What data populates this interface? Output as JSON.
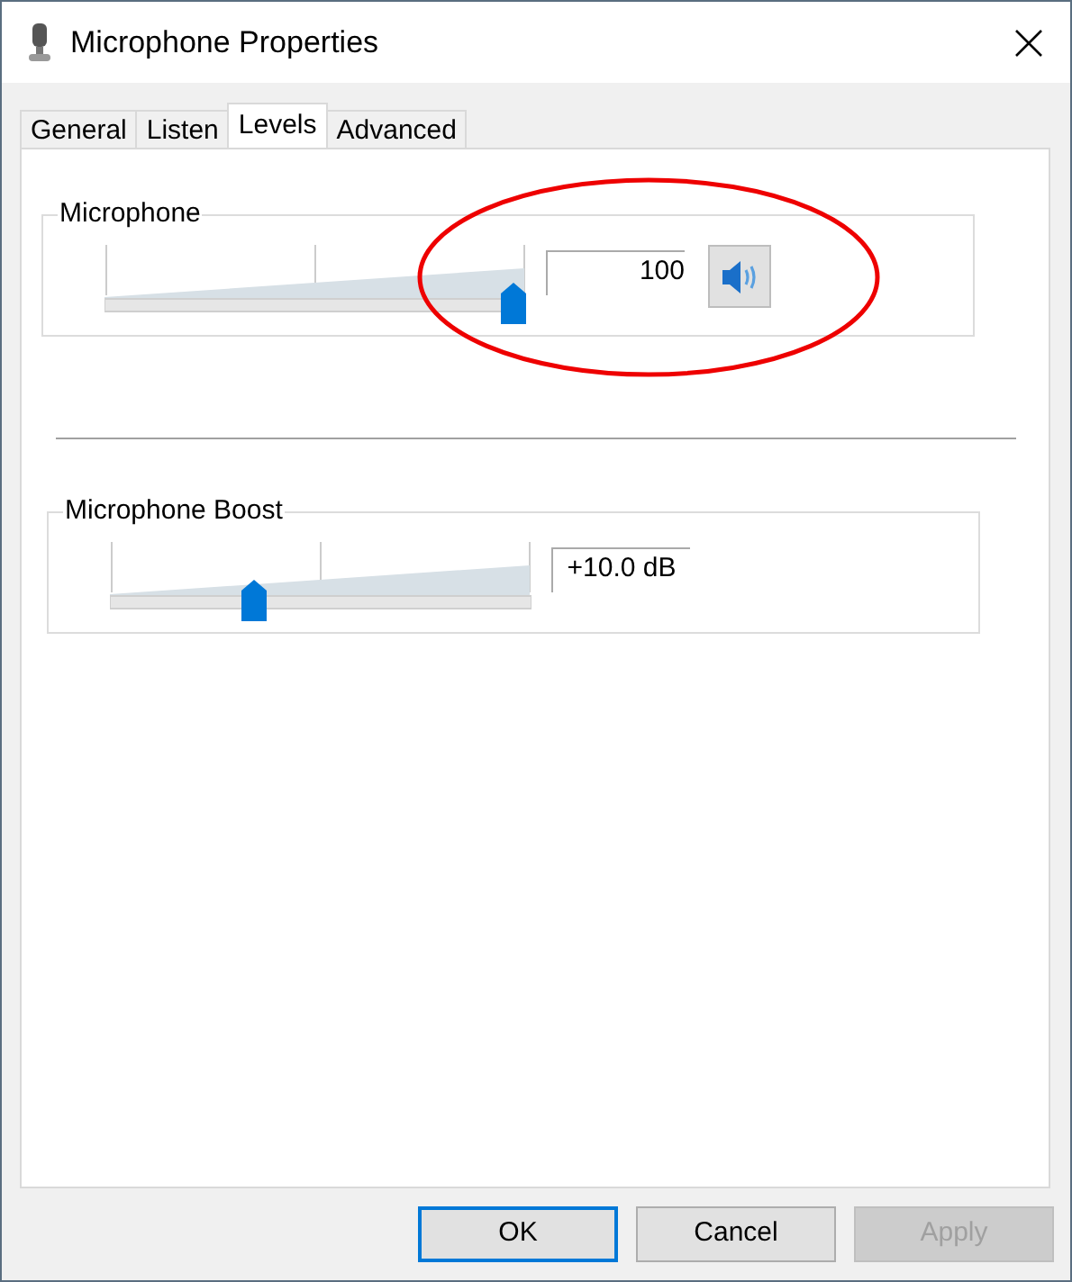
{
  "window": {
    "title": "Microphone Properties"
  },
  "tabs": [
    {
      "label": "General",
      "selected": false
    },
    {
      "label": "Listen",
      "selected": false
    },
    {
      "label": "Levels",
      "selected": true
    },
    {
      "label": "Advanced",
      "selected": false
    }
  ],
  "groups": [
    {
      "label": "Microphone",
      "level": 1.0,
      "reading": "100",
      "muted": false
    },
    {
      "label": "Microphone Boost",
      "level": 0.33,
      "reading": "+10.0 dB"
    }
  ],
  "buttons": [
    {
      "label": "OK",
      "default": true,
      "disabled": false
    },
    {
      "label": "Cancel",
      "default": false,
      "disabled": false
    },
    {
      "label": "Apply",
      "default": false,
      "disabled": true
    }
  ]
}
